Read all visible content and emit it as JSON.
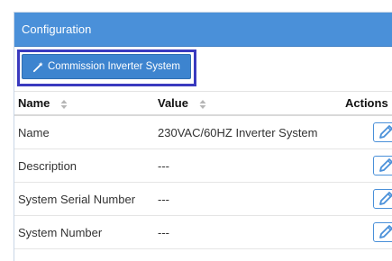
{
  "panel": {
    "title": "Configuration"
  },
  "toolbar": {
    "commission_label": "Commission Inverter System",
    "commission_icon": "magic-wand-icon"
  },
  "table": {
    "columns": [
      {
        "label": "Name",
        "sortable": true
      },
      {
        "label": "Value",
        "sortable": true
      },
      {
        "label": "Actions",
        "sortable": false
      }
    ],
    "rows": [
      {
        "name": "Name",
        "value": "230VAC/60HZ Inverter System",
        "action_icon": "edit-icon"
      },
      {
        "name": "Description",
        "value": "---",
        "action_icon": "edit-icon"
      },
      {
        "name": "System Serial Number",
        "value": "---",
        "action_icon": "edit-icon"
      },
      {
        "name": "System Number",
        "value": "---",
        "action_icon": "edit-icon"
      }
    ]
  },
  "colors": {
    "header_bg": "#4a90d9",
    "button_bg": "#3d84cf",
    "highlight_border": "#3a3abf",
    "edit_accent": "#4a90d9"
  }
}
